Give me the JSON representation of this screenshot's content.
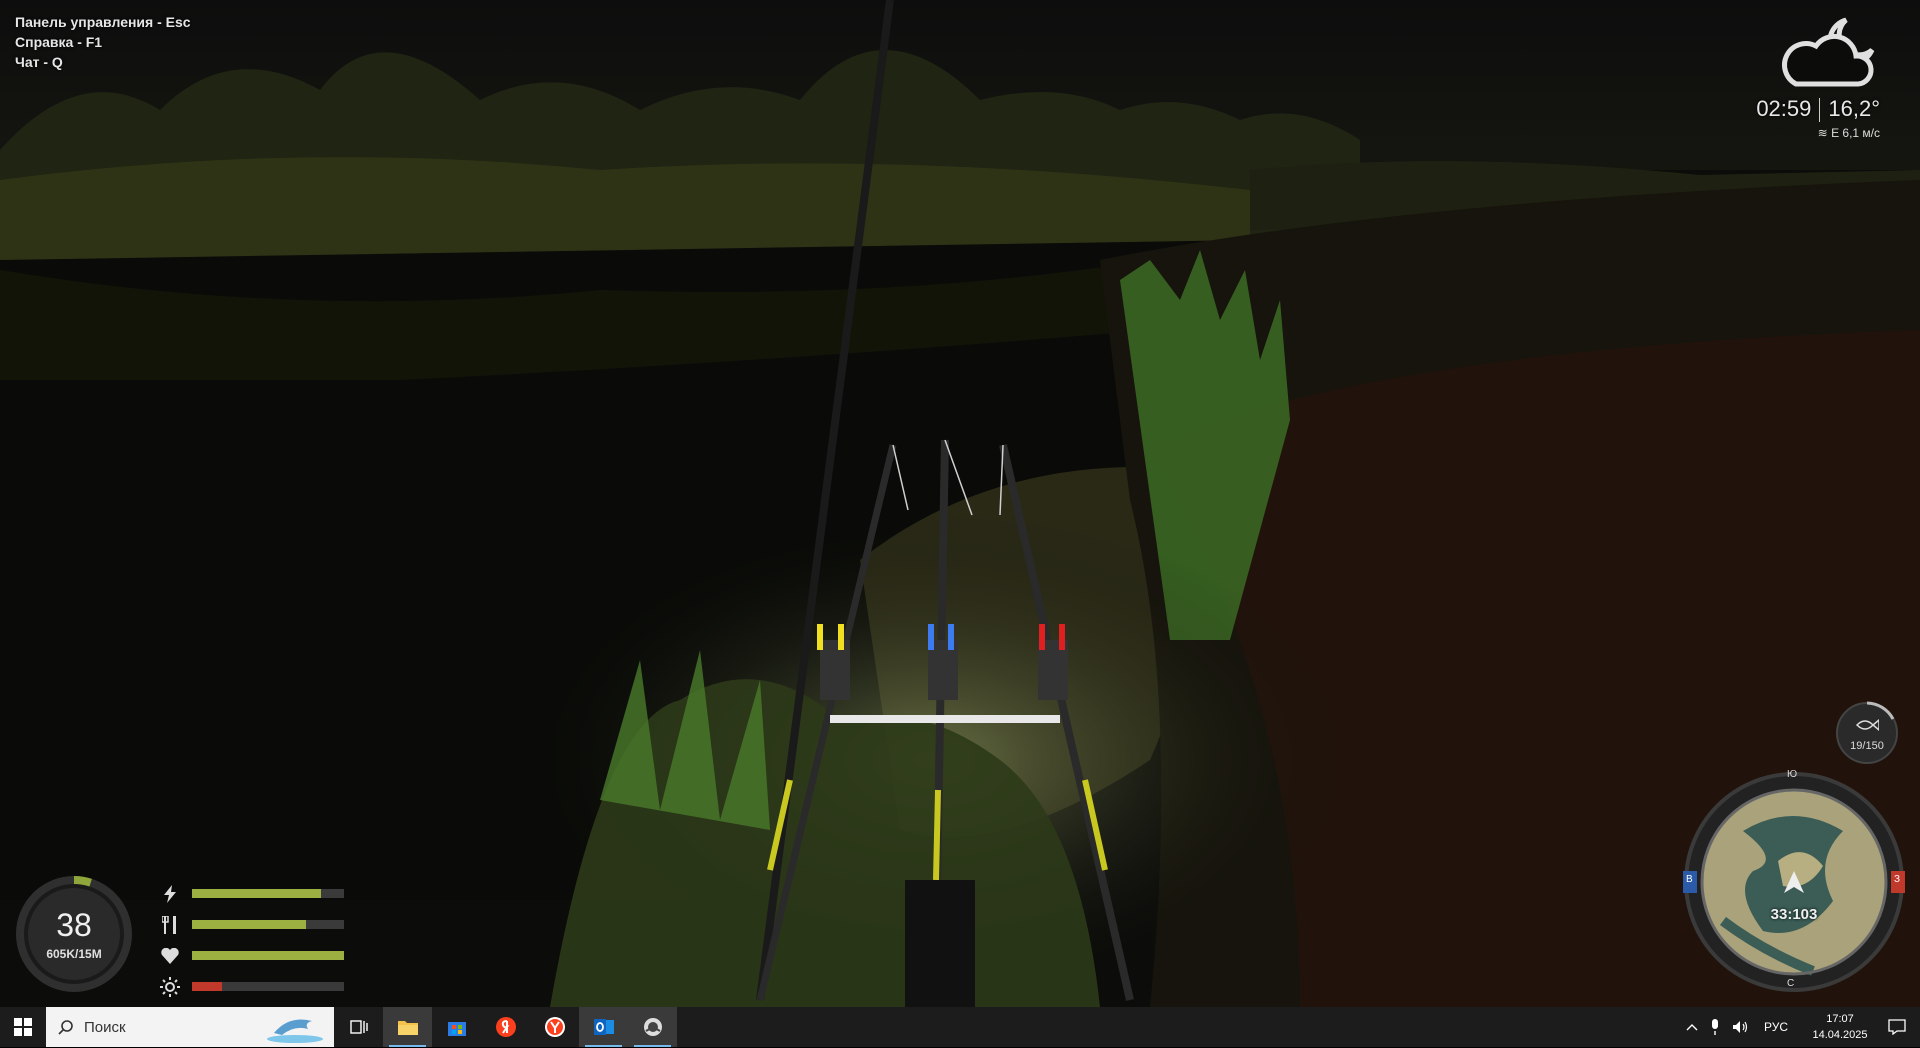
{
  "hud": {
    "hotkeys": [
      "Панель управления - Esc",
      "Справка - F1",
      "Чат - Q"
    ]
  },
  "weather": {
    "icon": "cloud-moon-icon",
    "time": "02:59",
    "temperature": "16,2°",
    "wind": "E 6,1 м/с"
  },
  "player": {
    "level": "38",
    "money": "605K",
    "money_max": "15M",
    "level_progress": 0.05
  },
  "stats": [
    {
      "name": "energy",
      "icon": "lightning-icon",
      "value": 0.85,
      "color": "#9bb040"
    },
    {
      "name": "food",
      "icon": "fork-knife-icon",
      "value": 0.75,
      "color": "#9bb040"
    },
    {
      "name": "health",
      "icon": "heart-icon",
      "value": 1.0,
      "color": "#9bb040"
    },
    {
      "name": "temperature",
      "icon": "sun-icon",
      "value": 0.2,
      "color": "#c0392b"
    }
  ],
  "keepnet": {
    "icon": "fish-icon",
    "count": "19/150"
  },
  "minimap": {
    "coords": "33:103",
    "north": "Ю",
    "west": "В",
    "east": "З",
    "south": "С"
  },
  "taskbar": {
    "search_placeholder": "Поиск",
    "apps": [
      {
        "name": "task-view",
        "icon": "task-view-icon",
        "active": false
      },
      {
        "name": "file-explorer",
        "icon": "folder-icon",
        "active": true
      },
      {
        "name": "store",
        "icon": "store-icon",
        "active": false
      },
      {
        "name": "yandex",
        "icon": "yandex-icon",
        "active": false
      },
      {
        "name": "yandex-browser",
        "icon": "yandex-browser-icon",
        "active": false
      },
      {
        "name": "outlook",
        "icon": "outlook-icon",
        "active": true
      },
      {
        "name": "game",
        "icon": "game-icon",
        "active": true
      }
    ],
    "language": "РУС",
    "time": "17:07",
    "date": "14.04.2025"
  }
}
